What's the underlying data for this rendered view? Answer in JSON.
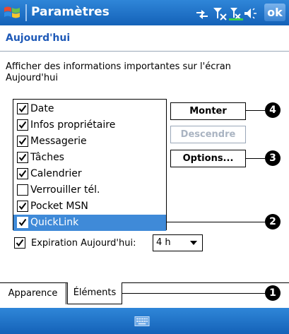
{
  "titlebar": {
    "title": "Paramètres",
    "ok_label": "ok"
  },
  "section_title": "Aujourd'hui",
  "description": "Afficher des informations importantes sur l'écran Aujourd'hui",
  "items": [
    {
      "label": "Date",
      "checked": true,
      "selected": false
    },
    {
      "label": "Infos propriétaire",
      "checked": true,
      "selected": false
    },
    {
      "label": "Messagerie",
      "checked": true,
      "selected": false
    },
    {
      "label": "Tâches",
      "checked": true,
      "selected": false
    },
    {
      "label": "Calendrier",
      "checked": true,
      "selected": false
    },
    {
      "label": "Verrouiller tél.",
      "checked": false,
      "selected": false
    },
    {
      "label": "Pocket MSN",
      "checked": true,
      "selected": false
    },
    {
      "label": "QuickLink",
      "checked": true,
      "selected": true
    }
  ],
  "buttons": {
    "up": "Monter",
    "down": "Descendre",
    "options": "Options..."
  },
  "expiration": {
    "label": "Expiration Aujourd'hui:",
    "value": "4 h",
    "checked": true
  },
  "tabs": {
    "appearance": "Apparence",
    "elements": "Éléments"
  },
  "callouts": {
    "c1": "1",
    "c2": "2",
    "c3": "3",
    "c4": "4"
  },
  "colors": {
    "titlebar": "#1f6fc6",
    "selection": "#3f8ad8",
    "section": "#1f5ab8"
  }
}
